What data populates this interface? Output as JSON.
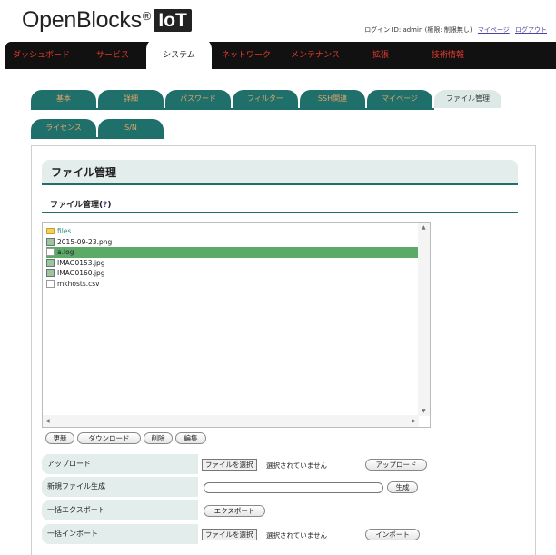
{
  "brand": {
    "name": "OpenBlocks",
    "reg": "®",
    "badge": "IoT"
  },
  "header": {
    "login_text": "ログイン ID: admin (権限: 制限無し)",
    "mypage_link": "マイページ",
    "logout_link": "ログアウト"
  },
  "mainnav": [
    "ダッシュボード",
    "サービス",
    "システム",
    "ネットワーク",
    "メンテナンス",
    "拡張",
    "技術情報"
  ],
  "tabs_row1": [
    "基本",
    "詳細",
    "パスワード",
    "フィルター",
    "SSH関連",
    "マイページ",
    "ファイル管理"
  ],
  "tabs_row2": [
    "ライセンス",
    "S/N"
  ],
  "page": {
    "section_title": "ファイル管理",
    "subheading": "ファイル管理",
    "help_link": "?"
  },
  "files": [
    {
      "name": "files",
      "type": "folder",
      "selected": false
    },
    {
      "name": "2015-09-23.png",
      "type": "image",
      "selected": false
    },
    {
      "name": "a.log",
      "type": "doc",
      "selected": true
    },
    {
      "name": "IMAG0153.jpg",
      "type": "image",
      "selected": false
    },
    {
      "name": "IMAG0160.jpg",
      "type": "image",
      "selected": false
    },
    {
      "name": "mkhosts.csv",
      "type": "doc",
      "selected": false
    }
  ],
  "actions": {
    "refresh": "更新",
    "download": "ダウンロード",
    "delete": "削除",
    "edit": "編集"
  },
  "form": {
    "upload_label": "アップロード",
    "choose_file": "ファイルを選択",
    "no_file": "選択されていません",
    "upload_button": "アップロード",
    "newfile_label": "新規ファイル生成",
    "newfile_value": "",
    "create_button": "生成",
    "export_label": "一括エクスポート",
    "export_button": "エクスポート",
    "import_label": "一括インポート",
    "import_button": "インポート"
  },
  "colors": {
    "nav_bg": "#111111",
    "nav_text": "#e43a2e",
    "tab_bg": "#1f6f6a",
    "tab_text": "#e5a46a",
    "selected_row": "#5caa68"
  }
}
